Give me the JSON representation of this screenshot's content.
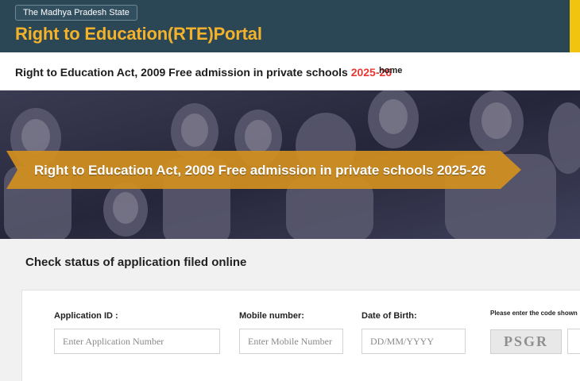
{
  "header": {
    "state_label": "The Madhya Pradesh State",
    "portal_title": "Right to Education(RTE)Portal"
  },
  "nav": {
    "title": "Right to Education Act, 2009 Free admission in private schools ",
    "year": "2025-26",
    "home_link": "home"
  },
  "banner": {
    "text": "Right to Education Act, 2009 Free admission in private schools 2025-26"
  },
  "status_form": {
    "title": "Check status of application filed online",
    "application_id": {
      "label": "Application ID :",
      "placeholder": "Enter Application Number",
      "value": ""
    },
    "mobile": {
      "label": "Mobile number:",
      "placeholder": "Enter Mobile Number",
      "value": ""
    },
    "dob": {
      "label": "Date of Birth:",
      "placeholder": "DD/MM/YYYY",
      "value": ""
    },
    "captcha_label": "Please enter the code shown",
    "captcha_code": "PSGR"
  },
  "colors": {
    "header_bg": "#2b4756",
    "title_orange": "#f3b22a",
    "year_red": "#e53935",
    "banner_arrow": "#d28f1f",
    "accent_yellow": "#f1c40f"
  }
}
